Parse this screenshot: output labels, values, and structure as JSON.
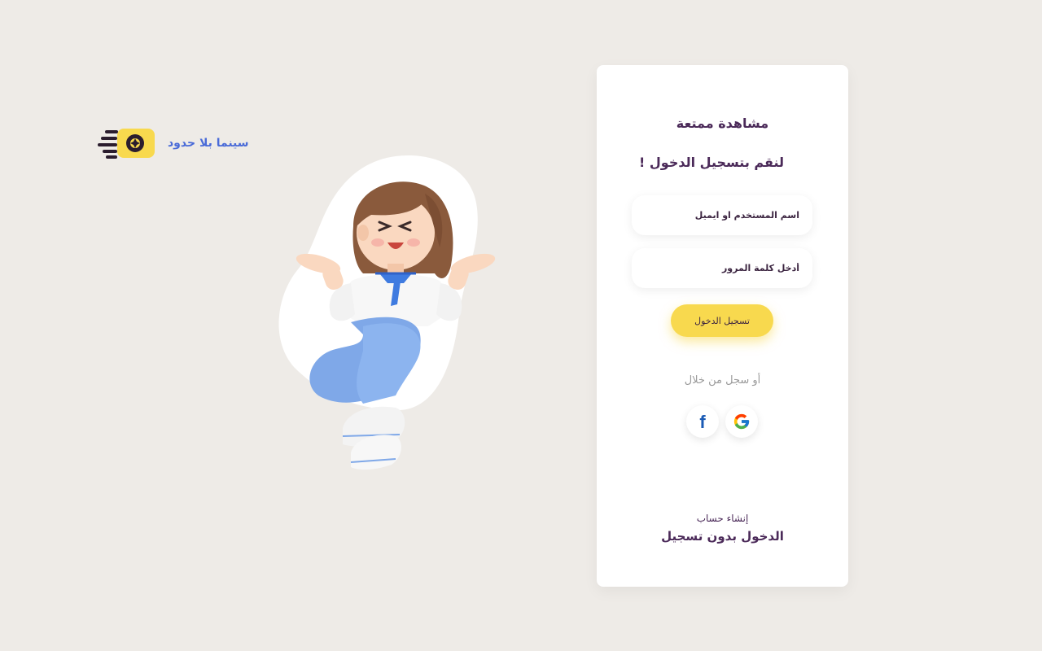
{
  "brand": {
    "name": "سينما بلا حدود",
    "logo_icon": "camera-aperture-icon",
    "accent_color": "#f8d94e",
    "brand_text_color": "#4a6bd8"
  },
  "illustration": {
    "icon": "shrugging-girl-illustration"
  },
  "login_card": {
    "title": "مشاهدة ممتعة",
    "subtitle": "لنقم بتسجيل الدخول !",
    "username_placeholder": "اسم المستخدم او ايميل",
    "password_placeholder": "أدخل كلمة المرور",
    "login_button": "تسجيل الدخول",
    "or_text": "أو سجل من خلال",
    "social": [
      {
        "name": "facebook",
        "icon": "facebook-icon"
      },
      {
        "name": "google",
        "icon": "google-icon"
      }
    ],
    "create_account": "إنشاء حساب",
    "guest_login": "الدخول بدون تسجيل",
    "text_color": "#4b2a59"
  }
}
